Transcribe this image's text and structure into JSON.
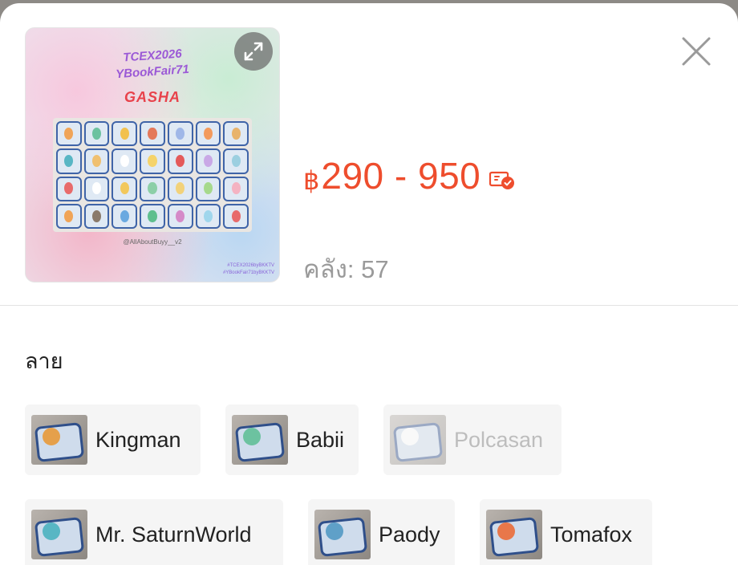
{
  "product": {
    "image": {
      "title_line1": "TCEX2026",
      "title_line2": "YBookFair71",
      "subtitle": "GASHA",
      "handle": "@AllAboutBuyy__v2",
      "tag1": "#TCEX2026byBKKTV",
      "tag2": "#YBookFair71byBKKTV"
    },
    "currency_symbol": "฿",
    "price_range": "290 - 950",
    "stock_text": "คลัง: 57"
  },
  "icons": {
    "expand": "expand-icon",
    "close": "close-icon",
    "voucher": "voucher-check-icon"
  },
  "colors": {
    "accent": "#ee4d2d",
    "muted_text": "#9a9a9a",
    "disabled_text": "#bdbdbd",
    "option_bg": "#f5f5f5"
  },
  "variation": {
    "label": "ลาย",
    "options": [
      {
        "label": "Kingman",
        "disabled": false
      },
      {
        "label": "Babii",
        "disabled": false
      },
      {
        "label": "Polcasan",
        "disabled": true
      },
      {
        "label": "Mr. SaturnWorld",
        "disabled": false
      },
      {
        "label": "Paody",
        "disabled": false
      },
      {
        "label": "Tomafox",
        "disabled": false
      }
    ]
  }
}
